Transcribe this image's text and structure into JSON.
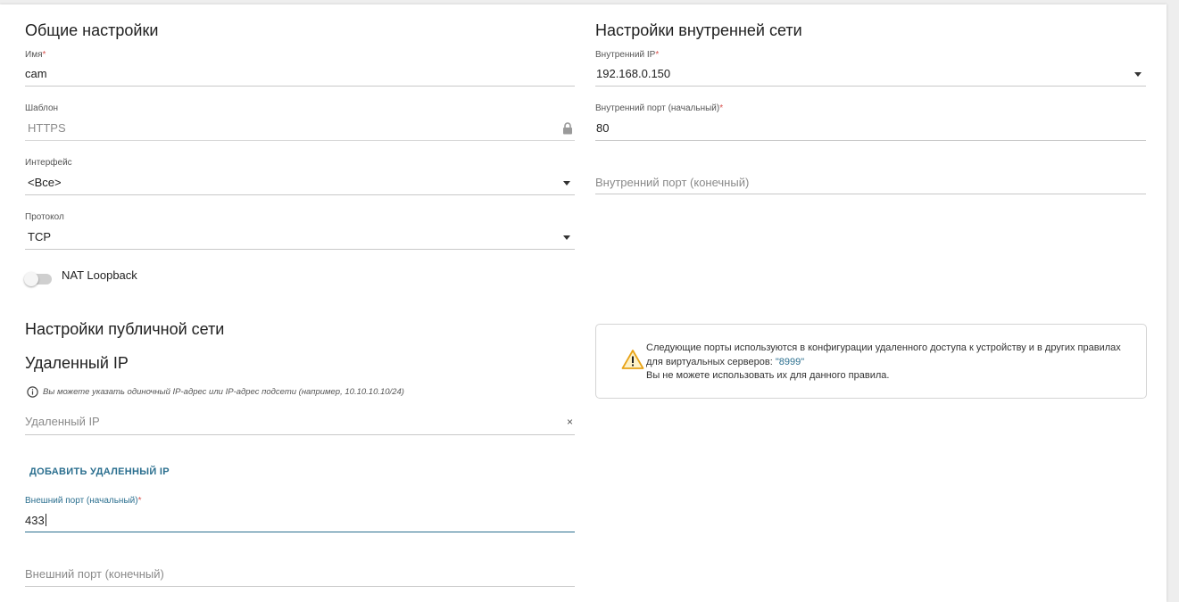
{
  "general": {
    "title": "Общие настройки",
    "name": {
      "label": "Имя",
      "required": "*",
      "value": "cam"
    },
    "template": {
      "label": "Шаблон",
      "value": "HTTPS"
    },
    "interface": {
      "label": "Интерфейс",
      "value": "<Все>"
    },
    "protocol": {
      "label": "Протокол",
      "value": "TCP"
    },
    "nat_loopback": {
      "label": "NAT Loopback",
      "enabled": false
    }
  },
  "internal": {
    "title": "Настройки внутренней сети",
    "ip": {
      "label": "Внутренний IP",
      "required": "*",
      "value": "192.168.0.150"
    },
    "port_start": {
      "label": "Внутренний порт (начальный)",
      "required": "*",
      "value": "80"
    },
    "port_end": {
      "placeholder": "Внутренний порт (конечный)"
    }
  },
  "public": {
    "title": "Настройки публичной сети",
    "remote_ip_title": "Удаленный IP",
    "hint": "Вы можете указать одиночный IP-адрес или IP-адрес подсети (например, 10.10.10.10/24)",
    "remote_ip": {
      "placeholder": "Удаленный IP",
      "clear": "×"
    },
    "add_remote_ip": "ДОБАВИТЬ УДАЛЕННЫЙ IP",
    "ext_port_start": {
      "label": "Внешний порт (начальный)",
      "required": "*",
      "value": "433"
    },
    "ext_port_end": {
      "placeholder": "Внешний порт (конечный)"
    }
  },
  "notice": {
    "text_before": "Следующие порты используются в конфигурации удаленного доступа к устройству и в других правилах для виртуальных серверов: ",
    "ports": "\"8999\"",
    "text_line2": "Вы не можете использовать их для данного правила."
  },
  "colors": {
    "accent": "#2b6f8f",
    "required": "#d9534f",
    "warning": "#e8a317"
  }
}
